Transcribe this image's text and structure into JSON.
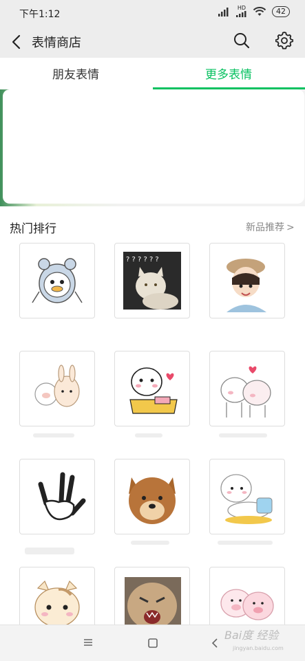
{
  "status_bar": {
    "time": "下午1:12",
    "network": "HD",
    "battery": "42"
  },
  "header": {
    "title": "表情商店"
  },
  "tabs": [
    {
      "label": "朋友表情",
      "active": false
    },
    {
      "label": "更多表情",
      "active": true
    }
  ],
  "section": {
    "title": "热门排行",
    "more_label": "新品推荐"
  },
  "stickers": [
    {
      "icon": "duck-hoodie-sticker"
    },
    {
      "icon": "confused-cat-sticker",
      "text": "? ? ? ? ? ?"
    },
    {
      "icon": "girl-beret-sticker"
    },
    {
      "icon": "pig-bunny-sticker"
    },
    {
      "icon": "blushing-bunny-sticker"
    },
    {
      "icon": "hugging-bears-sticker"
    },
    {
      "icon": "rock-hand-sticker"
    },
    {
      "icon": "shiba-dog-sticker"
    },
    {
      "icon": "lazy-bear-sticker"
    },
    {
      "icon": "chubby-cat-sticker"
    },
    {
      "icon": "angry-cat-sticker"
    },
    {
      "icon": "pink-pigs-sticker"
    }
  ],
  "colors": {
    "accent": "#07c160",
    "background": "#ededed"
  },
  "watermark": {
    "text": "Bai度 经验",
    "sub": "jingyan.baidu.com"
  }
}
